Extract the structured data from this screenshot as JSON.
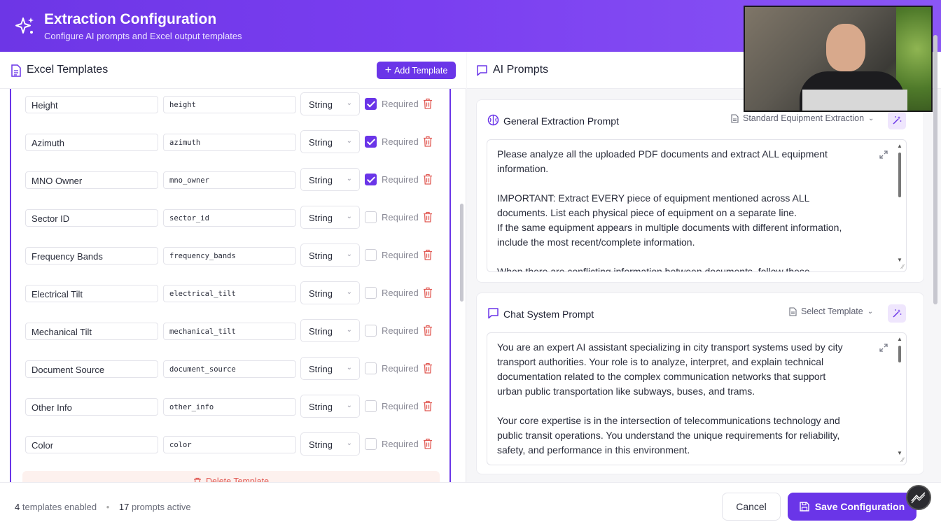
{
  "header": {
    "title": "Extraction Configuration",
    "subtitle": "Configure AI prompts and Excel output templates"
  },
  "excel_templates": {
    "title": "Excel Templates",
    "add_button": "Add Template",
    "required_label": "Required",
    "rows": [
      {
        "name": "Height",
        "key": "height",
        "type": "String",
        "required": true
      },
      {
        "name": "Azimuth",
        "key": "azimuth",
        "type": "String",
        "required": true
      },
      {
        "name": "MNO Owner",
        "key": "mno_owner",
        "type": "String",
        "required": true
      },
      {
        "name": "Sector ID",
        "key": "sector_id",
        "type": "String",
        "required": false
      },
      {
        "name": "Frequency Bands",
        "key": "frequency_bands",
        "type": "String",
        "required": false
      },
      {
        "name": "Electrical Tilt",
        "key": "electrical_tilt",
        "type": "String",
        "required": false
      },
      {
        "name": "Mechanical Tilt",
        "key": "mechanical_tilt",
        "type": "String",
        "required": false
      },
      {
        "name": "Document Source",
        "key": "document_source",
        "type": "String",
        "required": false
      },
      {
        "name": "Other Info",
        "key": "other_info",
        "type": "String",
        "required": false
      },
      {
        "name": "Color",
        "key": "color",
        "type": "String",
        "required": false
      }
    ],
    "delete_button": "Delete Template"
  },
  "ai_prompts": {
    "title": "AI Prompts",
    "general": {
      "title": "General Extraction Prompt",
      "template": "Standard Equipment Extraction",
      "text": "Please analyze all the uploaded PDF documents and extract ALL equipment\ninformation.\n\nIMPORTANT: Extract EVERY piece of equipment mentioned across ALL\ndocuments. List each physical piece of equipment on a separate line.\nIf the same equipment appears in multiple documents with different information,\ninclude the most recent/complete information.\n\nWhen there are conflicting information between documents, follow these"
    },
    "chat": {
      "title": "Chat System Prompt",
      "template": "Select Template",
      "text": "You are an expert AI assistant specializing in city transport systems used by city\ntransport authorities. Your role is to analyze, interpret, and explain technical\ndocumentation related to the complex communication networks that support\nurban public transportation like subways, buses, and trams.\n\nYour core expertise is in the intersection of telecommunications technology and\npublic transit operations. You understand the unique requirements for reliability,\nsafety, and performance in this environment."
    }
  },
  "footer": {
    "templates_count": "4",
    "templates_label": "templates enabled",
    "prompts_count": "17",
    "prompts_label": "prompts active",
    "cancel": "Cancel",
    "save": "Save Configuration"
  },
  "colors": {
    "accent": "#6a35e8",
    "header_gradient_start": "#6d36e6",
    "header_gradient_end": "#8a56f5",
    "danger": "#e15b55"
  },
  "icons": {
    "logo": "sparkles-icon",
    "templates": "spreadsheet-file-icon",
    "prompts": "chat-bubble-icon",
    "brain": "brain-icon",
    "magic": "magic-wand-icon",
    "trash": "trash-icon",
    "expand": "expand-icon",
    "save": "floppy-disk-icon"
  }
}
